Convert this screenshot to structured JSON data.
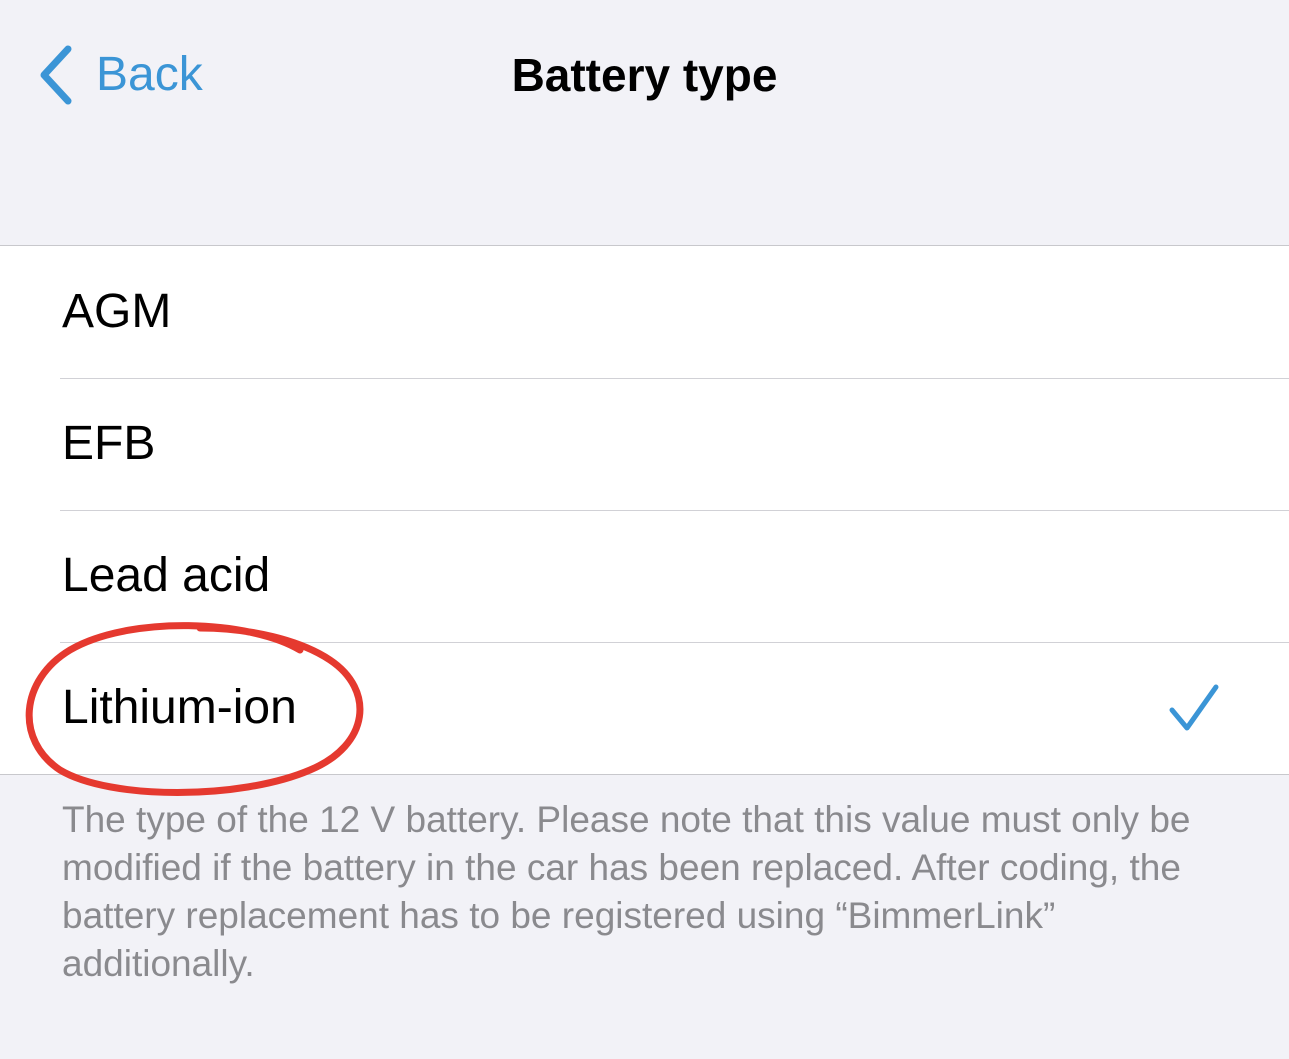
{
  "nav": {
    "back_label": "Back",
    "title": "Battery type"
  },
  "options": [
    {
      "label": "AGM",
      "selected": false
    },
    {
      "label": "EFB",
      "selected": false
    },
    {
      "label": "Lead acid",
      "selected": false
    },
    {
      "label": "Lithium-ion",
      "selected": true
    }
  ],
  "footer": {
    "note": "The type of the 12 V battery. Please note that this value must only be modified if the battery in the car has been replaced. After coding, the battery replacement has to be registered using “BimmerLink” additionally."
  },
  "colors": {
    "accent": "#3b95d6",
    "annotation": "#e5392f",
    "background": "#f2f2f7"
  },
  "icons": {
    "back": "chevron-left-icon",
    "selected": "checkmark-icon"
  }
}
